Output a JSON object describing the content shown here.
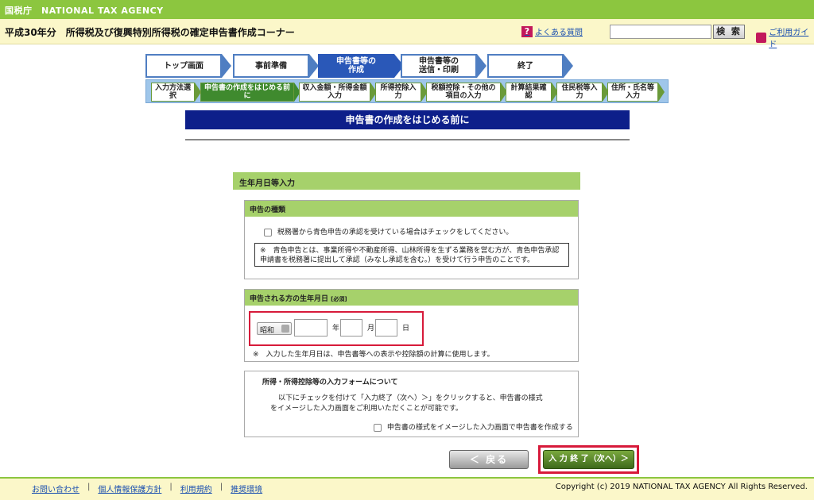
{
  "topbar": {
    "label": "国税庁　NATIONAL TAX AGENCY"
  },
  "header": {
    "title": "平成30年分　所得税及び復興特別所得税の確定申告書作成コーナー",
    "faq_label": "よくある質問",
    "search_placeholder": "",
    "search_button": "検 索",
    "guide_label": "ご利用ガイド"
  },
  "steps": [
    {
      "label": "トップ画面",
      "active": false
    },
    {
      "label": "事前準備",
      "active": false
    },
    {
      "label": "申告書等の\n作成",
      "active": true
    },
    {
      "label": "申告書等の\n送信・印刷",
      "active": false
    },
    {
      "label": "終了",
      "active": false
    }
  ],
  "substeps": [
    {
      "label": "入力方法選\n択",
      "active": false
    },
    {
      "label": "申告書の作成をはじめる前\nに",
      "active": true
    },
    {
      "label": "収入金額・所得金額\n入力",
      "active": false
    },
    {
      "label": "所得控除入\n力",
      "active": false
    },
    {
      "label": "税額控除・その他の\n項目の入力",
      "active": false
    },
    {
      "label": "計算結果確\n認",
      "active": false
    },
    {
      "label": "住民税等入\n力",
      "active": false
    },
    {
      "label": "住所・氏名等\n入力",
      "active": false
    }
  ],
  "page_title": "申告書の作成をはじめる前に",
  "section": {
    "title": "生年月日等入力",
    "shinkoku": {
      "head": "申告の種類",
      "checkbox_label": "税務署から青色申告の承認を受けている場合はチェックをしてください。",
      "note": "※　青色申告とは、事業所得や不動産所得、山林所得を生ずる業務を営む方が、青色申告承認申請書を税務署に提出して承認（みなし承認を含む。）を受けて行う申告のことです。"
    },
    "birth": {
      "head": "申告される方の生年月日",
      "required": "[必須]",
      "era_value": "昭和",
      "year_unit": "年",
      "month_unit": "月",
      "day_unit": "日",
      "note": "※　入力した生年月日は、申告書等への表示や控除額の計算に使用します。"
    },
    "form": {
      "head": "所得・所得控除等の入力フォームについて",
      "text1": "以下にチェックを付けて「入力終了（次へ）＞」をクリックすると、申告書の様式",
      "text2": "をイメージした入力画面をご利用いただくことが可能です。",
      "checkbox_label": "申告書の様式をイメージした入力画面で申告書を作成する"
    }
  },
  "buttons": {
    "back": "＜ 戻る",
    "next": "入 力 終 了（次へ）＞"
  },
  "footer": {
    "links": [
      "お問い合わせ",
      "個人情報保護方針",
      "利用規約",
      "推奨環境"
    ],
    "copyright": "Copyright (c) 2019 NATIONAL TAX AGENCY All Rights Reserved."
  }
}
